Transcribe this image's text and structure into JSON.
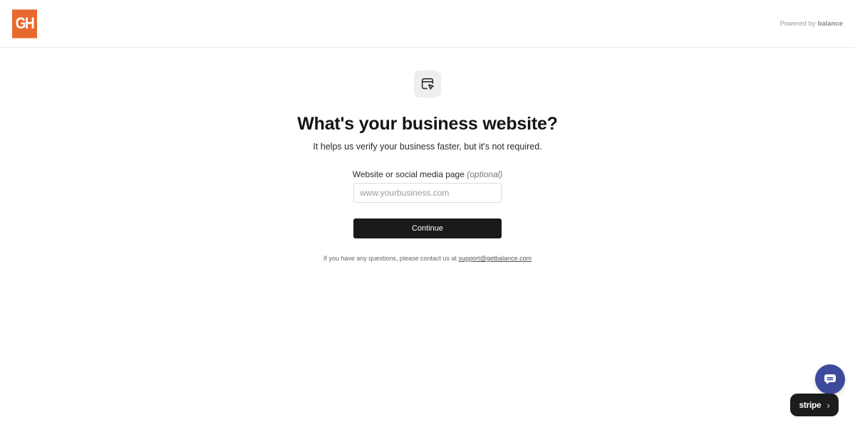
{
  "header": {
    "logo_text": "GH",
    "powered_prefix": "Powered by",
    "powered_brand": "balance"
  },
  "main": {
    "title": "What's your business website?",
    "subtitle": "It helps us verify your business faster, but it's not required.",
    "field_label": "Website or social media page",
    "field_optional": "(optional)",
    "website_input": {
      "value": "",
      "placeholder": "www.yourbusiness.com"
    },
    "continue_label": "Continue",
    "contact_prefix": "If you have any questions, please contact us at",
    "contact_email": "support@getbalance.com"
  },
  "widgets": {
    "stripe_label": "stripe",
    "chat_icon": "chat-bubble-icon",
    "stripe_chevron": "›"
  },
  "colors": {
    "logo_bg": "#e8692e",
    "button_bg": "#1a1a1a",
    "chat_bg": "#3d4a9c",
    "stripe_bg": "#1c1c1c"
  }
}
